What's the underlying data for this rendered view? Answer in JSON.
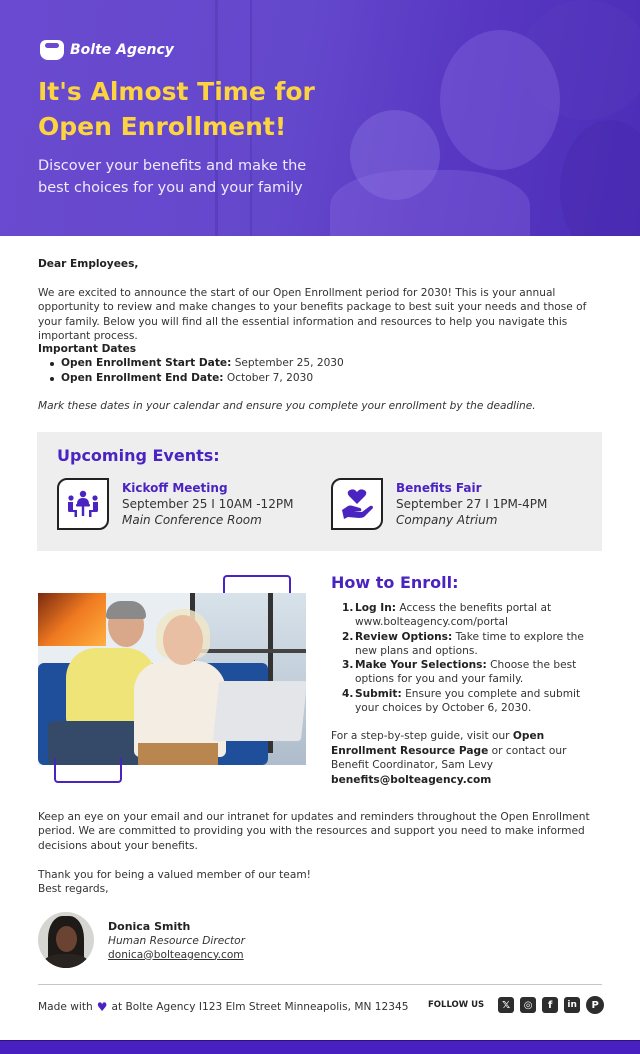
{
  "brand": {
    "name": "Bolte Agency",
    "accent_color": "#4a24c0",
    "headline_color": "#fcd341"
  },
  "hero": {
    "title": "It's Almost Time for Open Enrollment!",
    "subtitle": "Discover your benefits and make the best choices for you and your family"
  },
  "letter": {
    "greeting": "Dear Employees,",
    "intro": "We are excited to announce the start of our Open Enrollment period for 2030! This is your annual opportunity to review and make changes to your benefits package to best suit your needs and those of your family. Below you will find all the essential information and resources to help you navigate this important process.",
    "dates_title": "Important Dates",
    "dates": [
      {
        "label": "Open Enrollment Start Date:",
        "value": "September 25, 2030"
      },
      {
        "label": "Open Enrollment End Date:",
        "value": "October 7, 2030"
      }
    ],
    "reminder": "Mark these dates in your calendar and ensure you complete your enrollment by the deadline."
  },
  "events": {
    "title": "Upcoming Events:",
    "items": [
      {
        "icon": "meeting-icon",
        "name": "Kickoff Meeting",
        "when": "September 25 I 10AM -12PM",
        "where": "Main Conference Room"
      },
      {
        "icon": "heart-hand-icon",
        "name": "Benefits Fair",
        "when": "September 27 I 1PM-4PM",
        "where": "Company Atrium"
      }
    ]
  },
  "enroll": {
    "title": "How to Enroll:",
    "steps": [
      {
        "num": "1.",
        "label": "Log In:",
        "text": "Access the benefits portal at www.bolteagency.com/portal"
      },
      {
        "num": "2.",
        "label": "Review Options:",
        "text": "Take time to explore the new plans and options."
      },
      {
        "num": "3.",
        "label": "Make Your Selections:",
        "text": "Choose the best options for you and your family."
      },
      {
        "num": "4.",
        "label": "Submit:",
        "text": "Ensure you complete and submit your choices by October 6, 2030."
      }
    ],
    "guide_prefix": "For a step-by-step guide, visit our ",
    "guide_link": "Open Enrollment Resource Page",
    "guide_mid": " or contact our Benefit Coordinator, Sam Levy ",
    "guide_email": "benefits@bolteagency.com"
  },
  "closing": {
    "paragraph": "Keep an eye on your email and our intranet for updates and reminders throughout the Open Enrollment period. We are committed to providing you with the resources and support you need to make informed decisions about your benefits.",
    "thanks": "Thank you for being a valued member of our team!",
    "regards": "Best regards,"
  },
  "signature": {
    "name": "Donica Smith",
    "role": "Human Resource Director",
    "email": "donica@bolteagency.com"
  },
  "footer": {
    "made_prefix": "Made with",
    "made_suffix": "at Bolte Agency I123 Elm Street Minneapolis, MN 12345",
    "follow_label": "FOLLOW US",
    "social": [
      {
        "icon": "x-icon",
        "glyph": "𝕏"
      },
      {
        "icon": "instagram-icon",
        "glyph": "◎"
      },
      {
        "icon": "facebook-icon",
        "glyph": "f"
      },
      {
        "icon": "linkedin-icon",
        "glyph": "in"
      },
      {
        "icon": "pinterest-icon",
        "glyph": "P"
      }
    ]
  }
}
